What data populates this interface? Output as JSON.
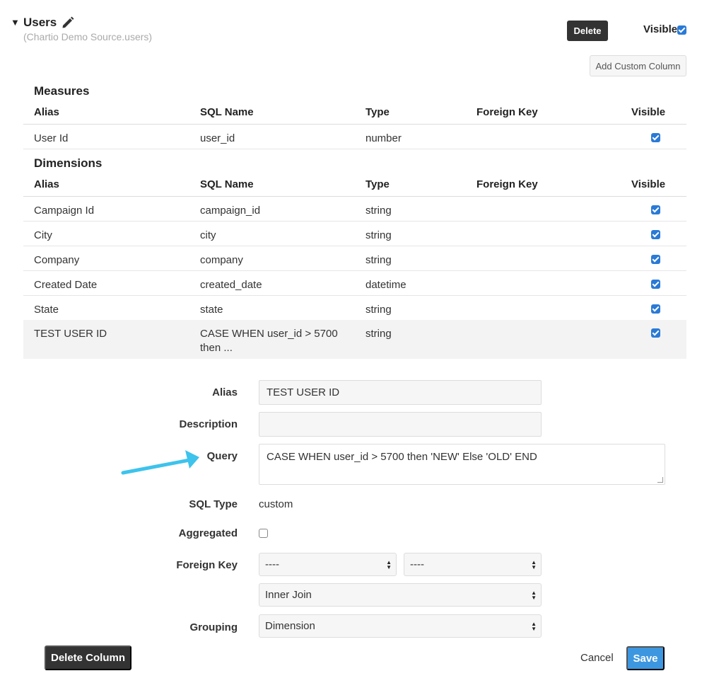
{
  "header": {
    "title": "Users",
    "source": "(Chartio Demo Source.users)",
    "delete_label": "Delete",
    "visible_label": "Visible",
    "visible_checked": true,
    "add_custom_column_label": "Add Custom Column"
  },
  "columns": {
    "alias": "Alias",
    "sql_name": "SQL Name",
    "type": "Type",
    "foreign_key": "Foreign Key",
    "visible": "Visible"
  },
  "measures": {
    "title": "Measures",
    "rows": [
      {
        "alias": "User Id",
        "sql_name": "user_id",
        "type": "number",
        "foreign_key": "",
        "visible": true
      }
    ]
  },
  "dimensions": {
    "title": "Dimensions",
    "rows": [
      {
        "alias": "Campaign Id",
        "sql_name": "campaign_id",
        "type": "string",
        "foreign_key": "",
        "visible": true
      },
      {
        "alias": "City",
        "sql_name": "city",
        "type": "string",
        "foreign_key": "",
        "visible": true
      },
      {
        "alias": "Company",
        "sql_name": "company",
        "type": "string",
        "foreign_key": "",
        "visible": true
      },
      {
        "alias": "Created Date",
        "sql_name": "created_date",
        "type": "datetime",
        "foreign_key": "",
        "visible": true
      },
      {
        "alias": "State",
        "sql_name": "state",
        "type": "string",
        "foreign_key": "",
        "visible": true
      },
      {
        "alias": "TEST USER ID",
        "sql_name_line1": "CASE WHEN user_id > 5700",
        "sql_name_line2": "then ...",
        "type": "string",
        "foreign_key": "",
        "visible": true,
        "selected": true
      }
    ]
  },
  "form": {
    "alias_label": "Alias",
    "alias_value": "TEST USER ID",
    "description_label": "Description",
    "description_value": "",
    "query_label": "Query",
    "query_value": "CASE WHEN user_id > 5700 then 'NEW' Else 'OLD' END",
    "sql_type_label": "SQL Type",
    "sql_type_value": "custom",
    "aggregated_label": "Aggregated",
    "aggregated_checked": false,
    "foreign_key_label": "Foreign Key",
    "foreign_key_table": "----",
    "foreign_key_column": "----",
    "join_type": "Inner Join",
    "grouping_label": "Grouping",
    "grouping_value": "Dimension"
  },
  "footer": {
    "delete_column_label": "Delete Column",
    "cancel_label": "Cancel",
    "save_label": "Save"
  },
  "colors": {
    "accent": "#3d97e0",
    "dark_button": "#333333",
    "checkbox": "#2a7ad6",
    "annotation_arrow": "#3dc3ec"
  }
}
